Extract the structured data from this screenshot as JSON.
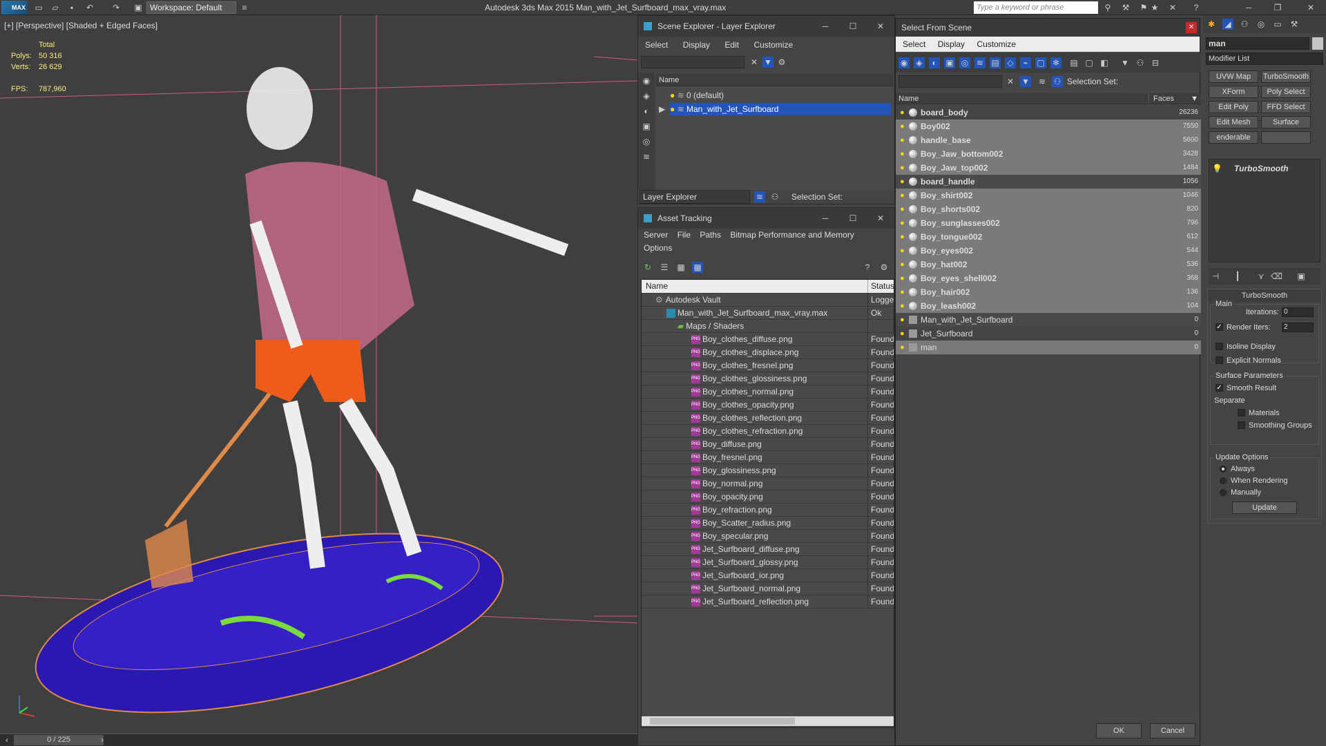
{
  "titlebar": {
    "workspace": "Workspace: Default",
    "app_title": "Autodesk 3ds Max  2015     Man_with_Jet_Surfboard_max_vray.max",
    "search_placeholder": "Type a keyword or phrase",
    "logo": "MAX"
  },
  "viewport": {
    "label": "[+] [Perspective] [Shaded + Edged Faces]",
    "stats": {
      "total_label": "Total",
      "polys_label": "Polys:",
      "polys_value": "50 316",
      "verts_label": "Verts:",
      "verts_value": "26 629",
      "fps_label": "FPS:",
      "fps_value": "787,960"
    },
    "frame_counter": "0 / 225"
  },
  "scene_explorer": {
    "title": "Scene Explorer - Layer Explorer",
    "menu": [
      "Select",
      "Display",
      "Edit",
      "Customize"
    ],
    "column_name": "Name",
    "items": [
      {
        "label": "0 (default)"
      },
      {
        "label": "Man_with_Jet_Surfboard"
      }
    ],
    "footer_dropdown": "Layer Explorer",
    "selection_set_label": "Selection Set:"
  },
  "asset_tracking": {
    "title": "Asset Tracking",
    "menu": [
      "Server",
      "File",
      "Paths",
      "Bitmap Performance and Memory"
    ],
    "menu2": "Options",
    "col_name": "Name",
    "col_status": "Status",
    "rows": [
      {
        "name": "Autodesk Vault",
        "status": "Logged"
      },
      {
        "name": "Man_with_Jet_Surfboard_max_vray.max",
        "status": "Ok"
      },
      {
        "name": "Maps / Shaders",
        "status": ""
      },
      {
        "name": "Boy_clothes_diffuse.png",
        "status": "Found"
      },
      {
        "name": "Boy_clothes_displace.png",
        "status": "Found"
      },
      {
        "name": "Boy_clothes_fresnel.png",
        "status": "Found"
      },
      {
        "name": "Boy_clothes_glossiness.png",
        "status": "Found"
      },
      {
        "name": "Boy_clothes_normal.png",
        "status": "Found"
      },
      {
        "name": "Boy_clothes_opacity.png",
        "status": "Found"
      },
      {
        "name": "Boy_clothes_reflection.png",
        "status": "Found"
      },
      {
        "name": "Boy_clothes_refraction.png",
        "status": "Found"
      },
      {
        "name": "Boy_diffuse.png",
        "status": "Found"
      },
      {
        "name": "Boy_fresnel.png",
        "status": "Found"
      },
      {
        "name": "Boy_glossiness.png",
        "status": "Found"
      },
      {
        "name": "Boy_normal.png",
        "status": "Found"
      },
      {
        "name": "Boy_opacity.png",
        "status": "Found"
      },
      {
        "name": "Boy_refraction.png",
        "status": "Found"
      },
      {
        "name": "Boy_Scatter_radius.png",
        "status": "Found"
      },
      {
        "name": "Boy_specular.png",
        "status": "Found"
      },
      {
        "name": "Jet_Surfboard_diffuse.png",
        "status": "Found"
      },
      {
        "name": "Jet_Surfboard_glossy.png",
        "status": "Found"
      },
      {
        "name": "Jet_Surfboard_ior.png",
        "status": "Found"
      },
      {
        "name": "Jet_Surfboard_normal.png",
        "status": "Found"
      },
      {
        "name": "Jet_Surfboard_reflection.png",
        "status": "Found"
      }
    ]
  },
  "select_from_scene": {
    "title": "Select From Scene",
    "menu": [
      "Select",
      "Display",
      "Customize"
    ],
    "selection_set_label": "Selection Set:",
    "col_name": "Name",
    "col_faces": "Faces",
    "rows": [
      {
        "name": "board_body",
        "faces": "26236"
      },
      {
        "name": "Boy002",
        "faces": "7550"
      },
      {
        "name": "handle_base",
        "faces": "5600"
      },
      {
        "name": "Boy_Jaw_bottom002",
        "faces": "3428"
      },
      {
        "name": "Boy_Jaw_top002",
        "faces": "1484"
      },
      {
        "name": "board_handle",
        "faces": "1056"
      },
      {
        "name": "Boy_shirt002",
        "faces": "1046"
      },
      {
        "name": "Boy_shorts002",
        "faces": "820"
      },
      {
        "name": "Boy_sunglasses002",
        "faces": "796"
      },
      {
        "name": "Boy_tongue002",
        "faces": "612"
      },
      {
        "name": "Boy_eyes002",
        "faces": "544"
      },
      {
        "name": "Boy_hat002",
        "faces": "536"
      },
      {
        "name": "Boy_eyes_shell002",
        "faces": "368"
      },
      {
        "name": "Boy_hair002",
        "faces": "136"
      },
      {
        "name": "Boy_leash002",
        "faces": "104"
      },
      {
        "name": "Man_with_Jet_Surfboard",
        "faces": "0"
      },
      {
        "name": "Jet_Surfboard",
        "faces": "0"
      },
      {
        "name": "man",
        "faces": "0"
      }
    ],
    "ok_label": "OK",
    "cancel_label": "Cancel"
  },
  "command_panel": {
    "object_name": "man",
    "modifier_list": "Modifier List",
    "buttons": [
      "UVW Map",
      "TurboSmooth",
      "XForm",
      "Poly Select",
      "Edit Poly",
      "FFD Select",
      "Edit Mesh",
      "Surface Select",
      "enderable Splin"
    ],
    "stack_item": "TurboSmooth",
    "rollout_title": "TurboSmooth",
    "main_label": "Main",
    "iterations_label": "Iterations:",
    "iterations_value": "0",
    "render_iters_label": "Render Iters:",
    "render_iters_value": "2",
    "isoline_label": "Isoline Display",
    "explicit_normals_label": "Explicit Normals",
    "surface_params_label": "Surface Parameters",
    "smooth_result_label": "Smooth Result",
    "separate_label": "Separate",
    "materials_label": "Materials",
    "smoothing_groups_label": "Smoothing Groups",
    "update_options_label": "Update Options",
    "always_label": "Always",
    "when_rendering_label": "When Rendering",
    "manually_label": "Manually",
    "update_button": "Update"
  }
}
